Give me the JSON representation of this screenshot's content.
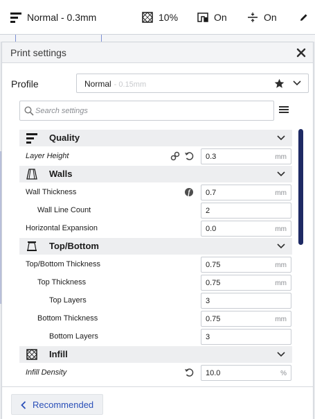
{
  "topbar": {
    "profile": "Normal - 0.3mm",
    "infill": "10%",
    "support": "On",
    "adhesion": "On"
  },
  "panel": {
    "title": "Print settings",
    "profile_label": "Profile",
    "profile_name": "Normal",
    "profile_sub": "- 0.15mm",
    "search_placeholder": "Search settings",
    "recommended_label": "Recommended"
  },
  "settings": {
    "quality": {
      "label": "Quality",
      "layer_height": {
        "label": "Layer Height",
        "value": "0.3",
        "unit": "mm"
      }
    },
    "walls": {
      "label": "Walls",
      "wall_thickness": {
        "label": "Wall Thickness",
        "value": "0.7",
        "unit": "mm"
      },
      "wall_line_count": {
        "label": "Wall Line Count",
        "value": "2"
      },
      "horizontal_expansion": {
        "label": "Horizontal Expansion",
        "value": "0.0",
        "unit": "mm"
      }
    },
    "topbottom": {
      "label": "Top/Bottom",
      "tb_thickness": {
        "label": "Top/Bottom Thickness",
        "value": "0.75",
        "unit": "mm"
      },
      "top_thickness": {
        "label": "Top Thickness",
        "value": "0.75",
        "unit": "mm"
      },
      "top_layers": {
        "label": "Top Layers",
        "value": "3"
      },
      "bottom_thickness": {
        "label": "Bottom Thickness",
        "value": "0.75",
        "unit": "mm"
      },
      "bottom_layers": {
        "label": "Bottom Layers",
        "value": "3"
      }
    },
    "infill": {
      "label": "Infill",
      "infill_density": {
        "label": "Infill Density",
        "value": "10.0",
        "unit": "%"
      }
    }
  },
  "colors": {
    "accent": "#2a4fb8",
    "scrollbar": "#1e2a64",
    "category_bg": "#edeef0"
  },
  "icons": {
    "topbar_profile": "layers-icon",
    "topbar_infill": "infill-icon",
    "topbar_support": "support-icon",
    "topbar_adhesion": "adhesion-icon",
    "topbar_edit": "pencil-icon",
    "close": "close-icon",
    "star": "star-icon",
    "search": "search-icon",
    "menu": "hamburger-icon",
    "link": "link-icon",
    "reset": "reset-icon",
    "info": "info-icon"
  }
}
